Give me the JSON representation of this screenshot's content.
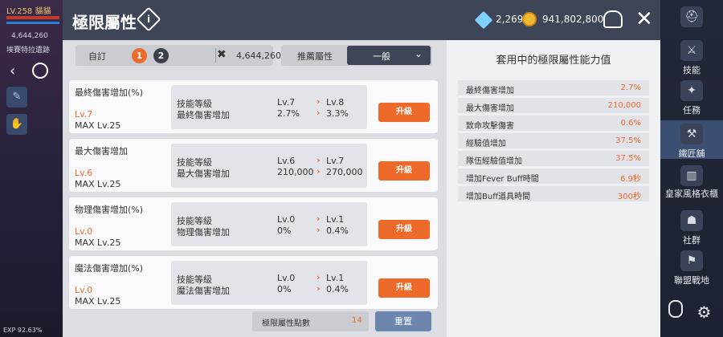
{
  "hud": {
    "level": "LV.258",
    "player_name": "貓貓",
    "hp_value": "4,644,260",
    "location": "埃賽特拉遺跡",
    "exp": "EXP 92.63%"
  },
  "sidebar": {
    "items": [
      {
        "label": "技能",
        "icon": "skill-icon"
      },
      {
        "label": "任務",
        "icon": "quest-icon"
      },
      {
        "label": "鐵匠舖",
        "icon": "anvil-icon"
      },
      {
        "label": "皇家風格衣櫃",
        "icon": "wardrobe-icon"
      },
      {
        "label": "社群",
        "icon": "community-icon"
      },
      {
        "label": "聯盟戰地",
        "icon": "alliance-icon"
      }
    ],
    "active_index": 2
  },
  "header": {
    "title": "極限屬性",
    "gems": "2,269",
    "gold": "941,802,800"
  },
  "toolbar": {
    "custom_label": "自訂",
    "presets": [
      "1",
      "2"
    ],
    "power": "4,644,260",
    "recommend_label": "推薦屬性",
    "recommend_value": "一般"
  },
  "skills": [
    {
      "name": "最終傷害增加(%)",
      "level": "Lv.7",
      "max": "MAX Lv.25",
      "key1": "技能等級",
      "key2": "最終傷害增加",
      "cur_lv": "Lv.7",
      "next_lv": "Lv.8",
      "cur_val": "2.7%",
      "next_val": "3.3%",
      "button": "升級"
    },
    {
      "name": "最大傷害增加",
      "level": "Lv.6",
      "max": "MAX Lv.25",
      "key1": "技能等級",
      "key2": "最大傷害增加",
      "cur_lv": "Lv.6",
      "next_lv": "Lv.7",
      "cur_val": "210,000",
      "next_val": "270,000",
      "button": "升級"
    },
    {
      "name": "物理傷害增加(%)",
      "level": "Lv.0",
      "max": "MAX Lv.25",
      "key1": "技能等級",
      "key2": "物理傷害增加",
      "cur_lv": "Lv.0",
      "next_lv": "Lv.1",
      "cur_val": "0%",
      "next_val": "0.4%",
      "button": "升級"
    },
    {
      "name": "魔法傷害增加(%)",
      "level": "Lv.0",
      "max": "MAX Lv.25",
      "key1": "技能等級",
      "key2": "魔法傷害增加",
      "cur_lv": "Lv.0",
      "next_lv": "Lv.1",
      "cur_val": "0%",
      "next_val": "0.4%",
      "button": "升級"
    }
  ],
  "footer": {
    "points_label": "極限屬性點數",
    "points": "14",
    "reset": "重置"
  },
  "summary": {
    "title": "套用中的極限屬性能力值",
    "rows": [
      {
        "label": "最終傷害增加",
        "value": "2.7%"
      },
      {
        "label": "最大傷害增加",
        "value": "210,000"
      },
      {
        "label": "致命攻擊傷害",
        "value": "0.6%"
      },
      {
        "label": "經驗值增加",
        "value": "37.5%"
      },
      {
        "label": "隊伍經驗值增加",
        "value": "37.5%"
      },
      {
        "label": "增加Fever Buff時間",
        "value": "6.9秒"
      },
      {
        "label": "增加Buff道具時間",
        "value": "300秒"
      }
    ]
  },
  "colors": {
    "accent": "#ee6a2a",
    "header_bg": "#3d4556",
    "reset_bg": "#6d86ae"
  }
}
